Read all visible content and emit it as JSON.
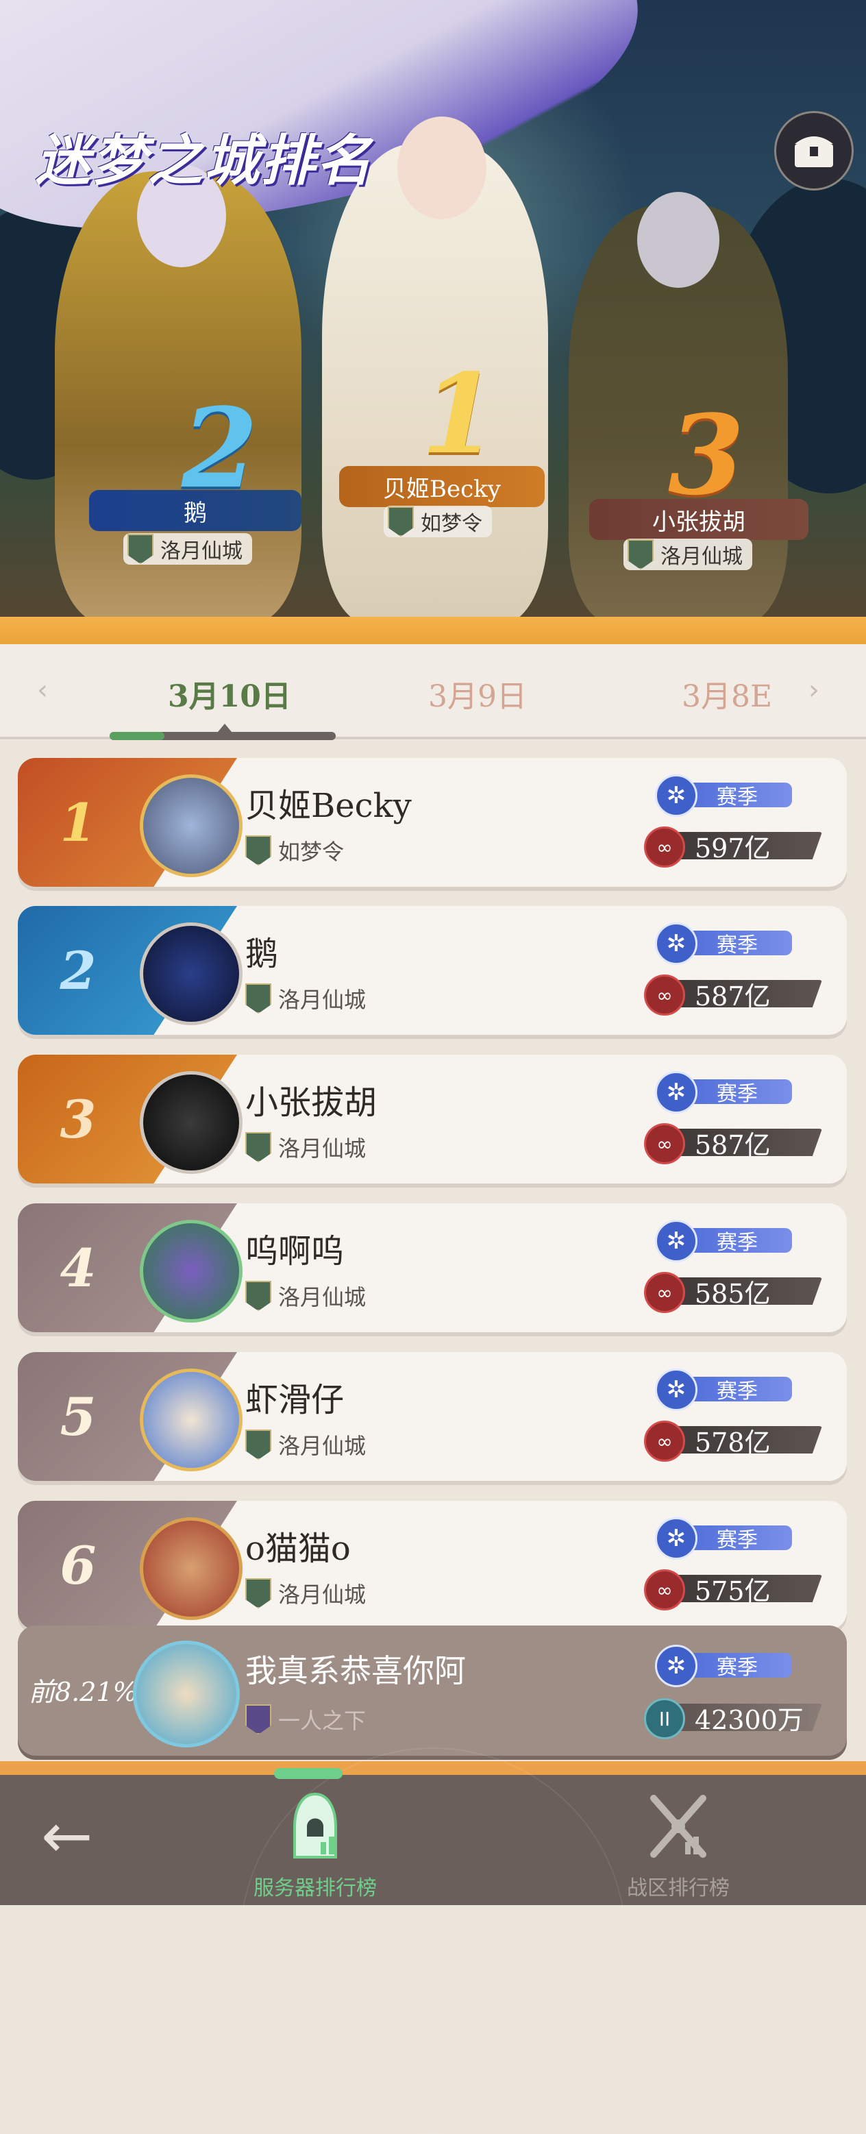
{
  "header": {
    "title": "迷梦之城排名",
    "corner_icon": "chest-icon"
  },
  "podium": [
    {
      "rank": "2",
      "name": "鹅",
      "guild": "洛月仙城"
    },
    {
      "rank": "1",
      "name": "贝姬Becky",
      "guild": "如梦令"
    },
    {
      "rank": "3",
      "name": "小张拔胡",
      "guild": "洛月仙城"
    }
  ],
  "date_tabs": {
    "items": [
      "3月10日",
      "3月9日",
      "3月8E"
    ],
    "active_index": 0,
    "prev_icon": "chevron-left-icon",
    "next_icon": "chevron-right-icon"
  },
  "rankings": [
    {
      "rank": "1",
      "name": "贝姬Becky",
      "guild": "如梦令",
      "season_label": "赛季",
      "score": "597亿"
    },
    {
      "rank": "2",
      "name": "鹅",
      "guild": "洛月仙城",
      "season_label": "赛季",
      "score": "587亿"
    },
    {
      "rank": "3",
      "name": "小张拔胡",
      "guild": "洛月仙城",
      "season_label": "赛季",
      "score": "587亿"
    },
    {
      "rank": "4",
      "name": "呜啊呜",
      "guild": "洛月仙城",
      "season_label": "赛季",
      "score": "585亿"
    },
    {
      "rank": "5",
      "name": "虾滑仔",
      "guild": "洛月仙城",
      "season_label": "赛季",
      "score": "578亿"
    },
    {
      "rank": "6",
      "name": "o猫猫o",
      "guild": "洛月仙城",
      "season_label": "赛季",
      "score": "575亿"
    }
  ],
  "my_rank": {
    "percentile": "前8.21%",
    "name": "我真系恭喜你阿",
    "guild": "一人之下",
    "season_label": "赛季",
    "score": "42300万",
    "tier": "II"
  },
  "bottom_nav": {
    "back_icon": "back-arrow-icon",
    "tabs": [
      {
        "label": "服务器排行榜",
        "active": true,
        "icon": "hooded-figure-icon"
      },
      {
        "label": "战区排行榜",
        "active": false,
        "icon": "crossed-swords-icon"
      }
    ]
  },
  "colors": {
    "rank1": "#d2662a",
    "rank2": "#2f86c4",
    "rank3": "#d8761c",
    "rank_other": "#8f7b7a",
    "active_tab": "#5a7a48",
    "inactive_tab": "#d3a592",
    "active_nav": "#6dcf8a",
    "inactive_nav": "#a8a09b"
  }
}
